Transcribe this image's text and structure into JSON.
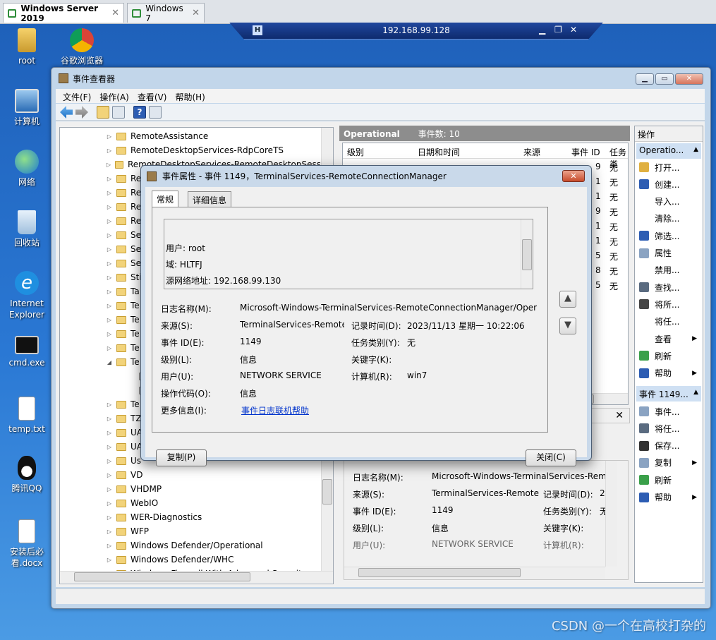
{
  "vm_tabs": [
    {
      "label": "Windows Server 2019",
      "active": true
    },
    {
      "label": "Windows 7",
      "active": false
    }
  ],
  "remote_bar": {
    "ip": "192.168.99.128"
  },
  "desktop_icons": [
    {
      "label": "root"
    },
    {
      "label": "谷歌浏览器"
    },
    {
      "label": "计算机"
    },
    {
      "label": "网络"
    },
    {
      "label": "回收站"
    },
    {
      "label": "Internet Explorer"
    },
    {
      "label": "cmd.exe"
    },
    {
      "label": "temp.txt"
    },
    {
      "label": "腾讯QQ"
    },
    {
      "label": "安装后必看.docx"
    }
  ],
  "window": {
    "title": "事件查看器",
    "menu": [
      "文件(F)",
      "操作(A)",
      "查看(V)",
      "帮助(H)"
    ]
  },
  "tree": [
    "RemoteAssistance",
    "RemoteDesktopServices-RdpCoreTS",
    "RemoteDesktopServices-RemoteDesktopSess",
    "Re",
    "Re",
    "Re",
    "Re",
    "Se",
    "Se",
    "Se",
    "Sti",
    "Ta",
    "Te",
    "Te",
    "Te",
    "Te",
    "Te",
    "",
    "",
    "Te",
    "TZ",
    "UA",
    "UA",
    "Us",
    "VD",
    "VHDMP",
    "WebIO",
    "WER-Diagnostics",
    "WFP",
    "Windows Defender/Operational",
    "Windows Defender/WHC",
    "Windows Firewall With Advanced Security"
  ],
  "list": {
    "title": "Operational",
    "count": "事件数: 10",
    "columns": [
      "级别",
      "日期和时间",
      "来源",
      "事件 ID",
      "任务类"
    ],
    "rows": [
      {
        "id": "9",
        "task": "无"
      },
      {
        "id": "1",
        "task": "无"
      },
      {
        "id": "1",
        "task": "无"
      },
      {
        "id": "9",
        "task": "无"
      },
      {
        "id": "1",
        "task": "无"
      },
      {
        "id": "1",
        "task": "无"
      },
      {
        "id": "5",
        "task": "无"
      },
      {
        "id": "8",
        "task": "无"
      },
      {
        "id": "5",
        "task": "无"
      }
    ]
  },
  "detail": {
    "log_name_label": "日志名称(M):",
    "log_name_value": "Microsoft-Windows-TerminalServices-Rem",
    "source_label": "来源(S):",
    "source_value": "TerminalServices-Remote",
    "logged_label": "记录时间(D):",
    "logged_value": "20",
    "event_id_label": "事件 ID(E):",
    "event_id_value": "1149",
    "task_label": "任务类别(Y):",
    "task_value": "无",
    "level_label": "级别(L):",
    "level_value": "信息",
    "keywords_label": "关键字(K):",
    "user_label": "用户(U):",
    "user_value": "NETWORK SERVICE",
    "computer_label": "计算机(R):"
  },
  "actions": {
    "header": "操作",
    "section1": "Operatio...",
    "items1": [
      "打开...",
      "创建...",
      "导入...",
      "清除...",
      "筛选...",
      "属性",
      "禁用...",
      "查找...",
      "将所...",
      "将任...",
      "查看",
      "刷新",
      "帮助"
    ],
    "section2": "事件 1149...",
    "items2": [
      "事件...",
      "将任...",
      "保存...",
      "复制",
      "刷新",
      "帮助"
    ]
  },
  "dialog": {
    "title": "事件属性 - 事件 1149，TerminalServices-RemoteConnectionManager",
    "close": "✕",
    "tab_general": "常规",
    "tab_details": "详细信息",
    "message": {
      "user": "用户: root",
      "domain": "域: HLTFJ",
      "source_ip": "源网络地址: 192.168.99.130"
    },
    "log_name_label": "日志名称(M):",
    "log_name_value": "Microsoft-Windows-TerminalServices-RemoteConnectionManager/Oper",
    "source_label": "来源(S):",
    "source_value": "TerminalServices-Remote",
    "logged_label": "记录时间(D):",
    "logged_value": "2023/11/13 星期一 10:22:06",
    "event_id_label": "事件 ID(E):",
    "event_id_value": "1149",
    "task_label": "任务类别(Y):",
    "task_value": "无",
    "level_label": "级别(L):",
    "level_value": "信息",
    "keywords_label": "关键字(K):",
    "user_label": "用户(U):",
    "user_value": "NETWORK SERVICE",
    "computer_label": "计算机(R):",
    "computer_value": "win7",
    "opcode_label": "操作代码(O):",
    "opcode_value": "信息",
    "more_info_label": "更多信息(I):",
    "more_info_link": "事件日志联机帮助",
    "copy_button": "复制(P)",
    "close_button": "关闭(C)"
  },
  "watermark": "CSDN @一个在高校打杂的"
}
